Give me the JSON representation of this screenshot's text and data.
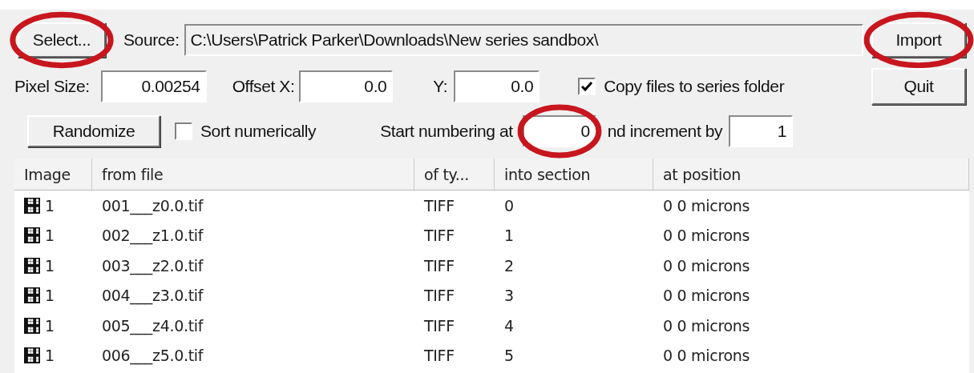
{
  "source_row": {
    "select_button": {
      "label": "Select...",
      "highlighted": true
    },
    "source_label": "Source:",
    "source_value": "C:\\Users\\Patrick Parker\\Downloads\\New series sandbox\\",
    "import_button": {
      "label": "Import",
      "highlighted": true
    }
  },
  "offset_row": {
    "pixel_size": {
      "label": "Pixel Size:",
      "value": "0.00254"
    },
    "offset_x": {
      "label": "Offset X:",
      "value": "0.0"
    },
    "offset_y": {
      "label": "Y:",
      "value": "0.0"
    },
    "copy_files": {
      "label": "Copy files to series folder",
      "checked": true
    },
    "quit_button": {
      "label": "Quit"
    }
  },
  "numbering_row": {
    "randomize_button": {
      "label": "Randomize"
    },
    "sort_numerically": {
      "label": "Sort numerically",
      "checked": false
    },
    "start_label": "Start numbering at",
    "start_value": {
      "value": "0",
      "highlighted": true
    },
    "increment_label": "nd increment by",
    "increment_value": {
      "value": "1"
    }
  },
  "table": {
    "columns": [
      "Image",
      "from file",
      "of ty...",
      "into section",
      "at position"
    ],
    "rows": [
      {
        "image": "1",
        "file": "001___z0.0.tif",
        "type": "TIFF",
        "section": "0",
        "position": "0 0 microns"
      },
      {
        "image": "1",
        "file": "002___z1.0.tif",
        "type": "TIFF",
        "section": "1",
        "position": "0 0 microns"
      },
      {
        "image": "1",
        "file": "003___z2.0.tif",
        "type": "TIFF",
        "section": "2",
        "position": "0 0 microns"
      },
      {
        "image": "1",
        "file": "004___z3.0.tif",
        "type": "TIFF",
        "section": "3",
        "position": "0 0 microns"
      },
      {
        "image": "1",
        "file": "005___z4.0.tif",
        "type": "TIFF",
        "section": "4",
        "position": "0 0 microns"
      },
      {
        "image": "1",
        "file": "006___z5.0.tif",
        "type": "TIFF",
        "section": "5",
        "position": "0 0 microns"
      }
    ]
  }
}
